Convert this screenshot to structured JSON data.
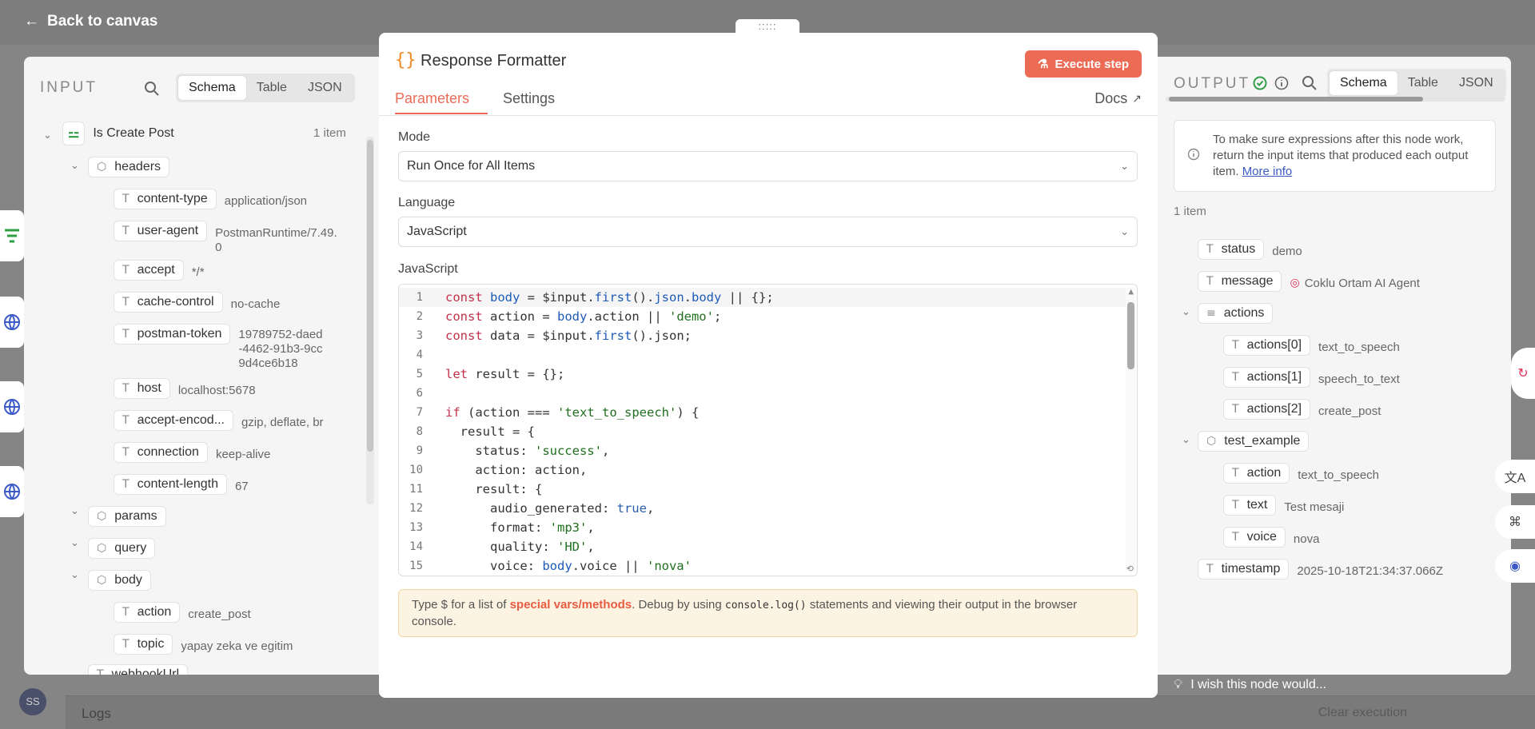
{
  "nav": {
    "back_label": "Back to canvas",
    "grip_label": ":::::"
  },
  "logs": {
    "label": "Logs",
    "clear_label": "Clear execution"
  },
  "user": {
    "initials": "SS"
  },
  "input": {
    "title": "INPUT",
    "tabs": [
      "Schema",
      "Table",
      "JSON"
    ],
    "active_tab": "Schema",
    "node_name": "Is Create Post",
    "item_count": "1 item",
    "headers_label": "headers",
    "headers": [
      {
        "key": "content-type",
        "value": "application/json"
      },
      {
        "key": "user-agent",
        "value": "PostmanRuntime/7.49.0"
      },
      {
        "key": "accept",
        "value": "*/*"
      },
      {
        "key": "cache-control",
        "value": "no-cache"
      },
      {
        "key": "postman-token",
        "value": "19789752-daed-4462-91b3-9cc9d4ce6b18"
      },
      {
        "key": "host",
        "value": "localhost:5678"
      },
      {
        "key": "accept-encod...",
        "value": "gzip, deflate, br"
      },
      {
        "key": "connection",
        "value": "keep-alive"
      },
      {
        "key": "content-length",
        "value": "67"
      }
    ],
    "params_label": "params",
    "query_label": "query",
    "body_label": "body",
    "body": [
      {
        "key": "action",
        "value": "create_post"
      },
      {
        "key": "topic",
        "value": "yapay zeka ve egitim"
      }
    ],
    "cut_label": "webhookUrl"
  },
  "node": {
    "icon": "{}",
    "title": "Response Formatter",
    "execute_label": "Execute step",
    "tabs": [
      "Parameters",
      "Settings"
    ],
    "active_tab": "Parameters",
    "docs_label": "Docs",
    "mode_label": "Mode",
    "mode_value": "Run Once for All Items",
    "language_label": "Language",
    "language_value": "JavaScript",
    "code_label": "JavaScript",
    "hint_pre": "Type $ for a list of",
    "hint_link": "special vars/methods",
    "hint_mid": ". Debug by using",
    "hint_code": "console.log()",
    "hint_post": "statements and viewing their output in the browser console."
  },
  "code": [
    "const body = $input.first().json.body || {};",
    "const action = body.action || 'demo';",
    "const data = $input.first().json;",
    "",
    "let result = {};",
    "",
    "if (action === 'text_to_speech') {",
    "  result = {",
    "    status: 'success',",
    "    action: action,",
    "    result: {",
    "      audio_generated: true,",
    "      format: 'mp3',",
    "      quality: 'HD',",
    "      voice: body.voice || 'nova'"
  ],
  "output": {
    "title": "OUTPUT",
    "tabs": [
      "Schema",
      "Table",
      "JSON"
    ],
    "active_tab": "Schema",
    "info_text": "To make sure expressions after this node work, return the input items that produced each output item.",
    "info_link": "More info",
    "item_count": "1 item",
    "status": {
      "key": "status",
      "value": "demo"
    },
    "message": {
      "key": "message",
      "value": "Coklu Ortam AI Agent"
    },
    "actions_label": "actions",
    "actions": [
      {
        "key": "actions[0]",
        "value": "text_to_speech"
      },
      {
        "key": "actions[1]",
        "value": "speech_to_text"
      },
      {
        "key": "actions[2]",
        "value": "create_post"
      }
    ],
    "test_label": "test_example",
    "test": [
      {
        "key": "action",
        "value": "text_to_speech"
      },
      {
        "key": "text",
        "value": "Test mesaji"
      },
      {
        "key": "voice",
        "value": "nova"
      }
    ],
    "timestamp": {
      "key": "timestamp",
      "value": "2025-10-18T21:34:37.066Z"
    }
  },
  "feedback": {
    "label": "I wish this node would..."
  },
  "colors": {
    "accent": "#ec6b55",
    "success": "#2f9e44",
    "link": "#3b5ac8"
  }
}
